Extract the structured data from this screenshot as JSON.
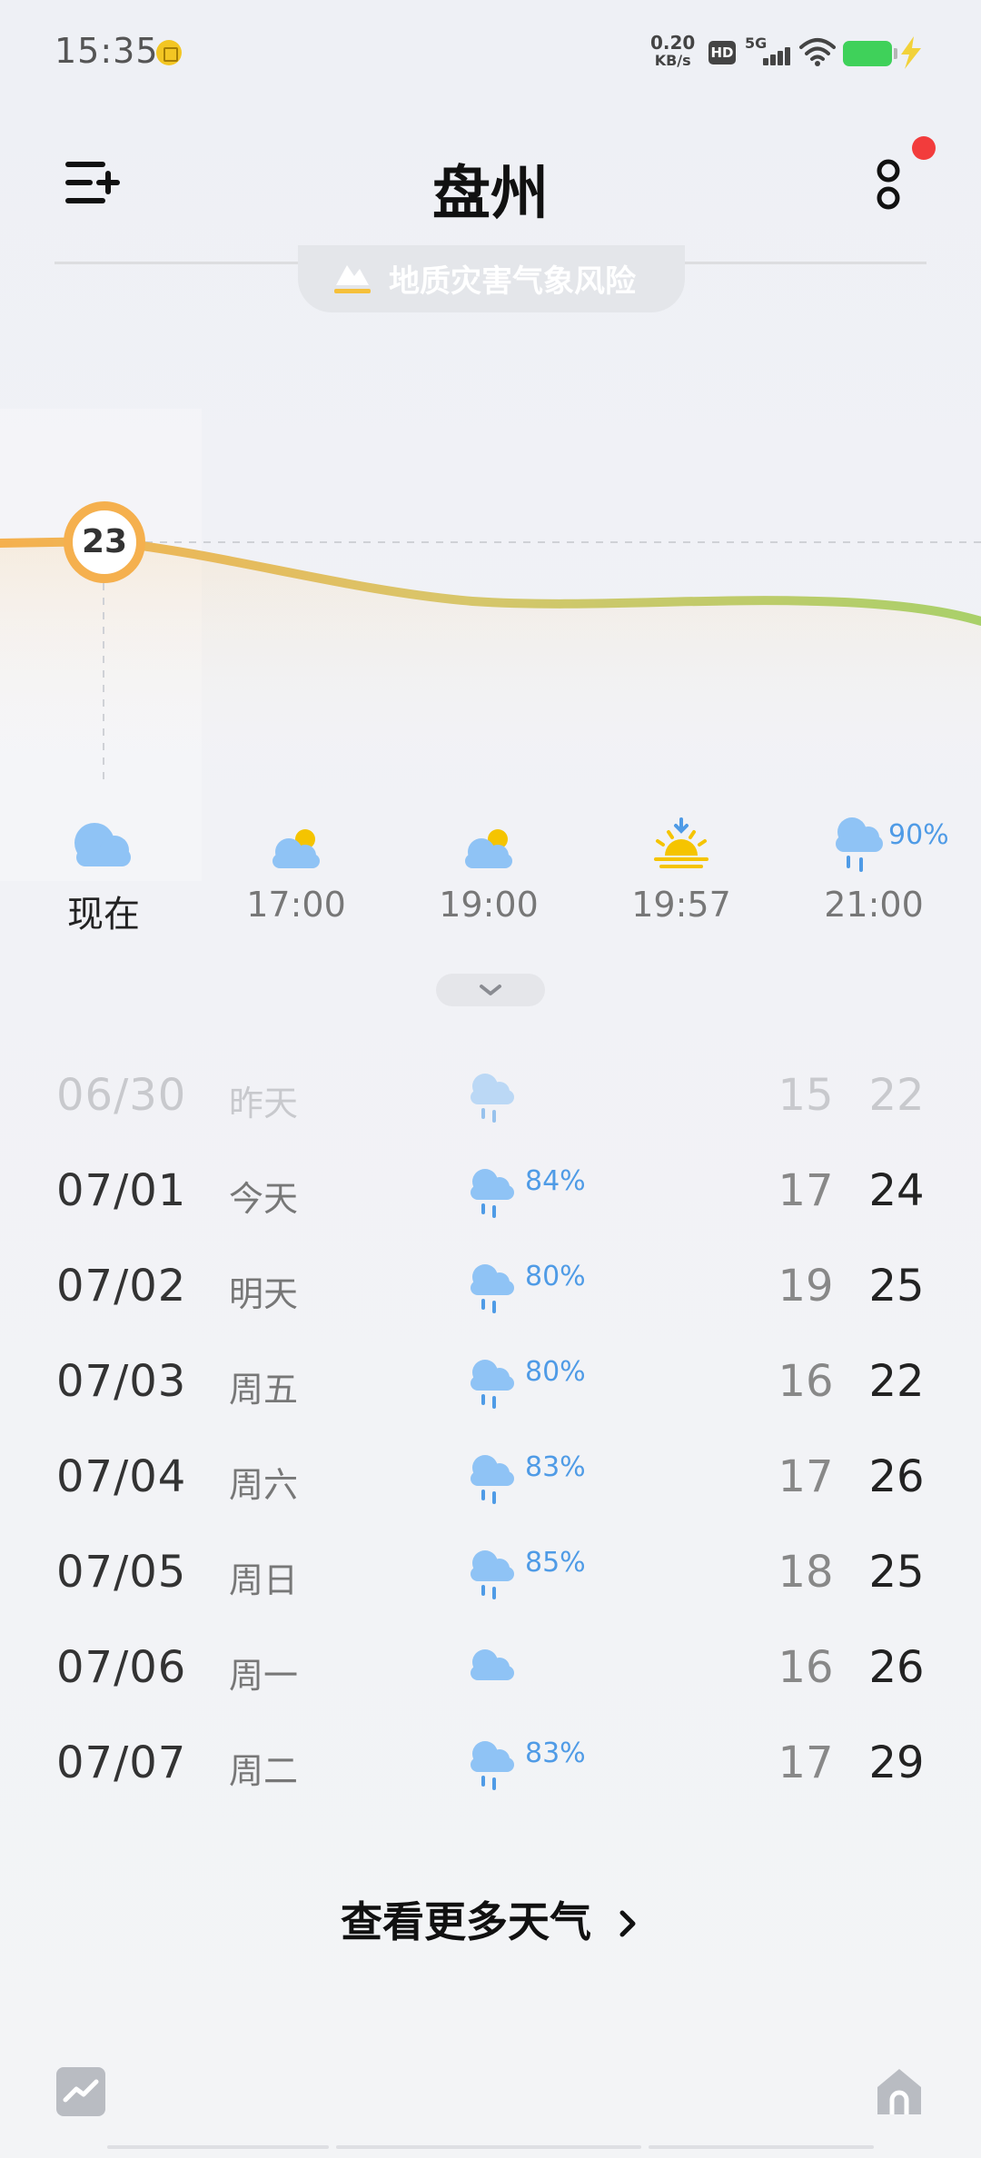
{
  "status_bar": {
    "time": "15:35",
    "net_speed_value": "0.20",
    "net_speed_unit": "KB/s",
    "hd_label": "HD",
    "signal_label": "5G"
  },
  "header": {
    "city": "盘州",
    "warning_text": "地质灾害气象风险"
  },
  "current": {
    "temp": "23"
  },
  "hourly": [
    {
      "label": "现在",
      "icon": "cloudy-icon",
      "precip": ""
    },
    {
      "label": "17:00",
      "icon": "partly-cloudy-icon",
      "precip": ""
    },
    {
      "label": "19:00",
      "icon": "partly-cloudy-icon",
      "precip": ""
    },
    {
      "label": "19:57",
      "icon": "sunset-icon",
      "precip": ""
    },
    {
      "label": "21:00",
      "icon": "rain-icon",
      "precip": "90%"
    }
  ],
  "daily": [
    {
      "date": "06/30",
      "day": "昨天",
      "icon": "rain-icon",
      "precip": "",
      "low": "15",
      "high": "22"
    },
    {
      "date": "07/01",
      "day": "今天",
      "icon": "rain-icon",
      "precip": "84%",
      "low": "17",
      "high": "24"
    },
    {
      "date": "07/02",
      "day": "明天",
      "icon": "rain-icon",
      "precip": "80%",
      "low": "19",
      "high": "25"
    },
    {
      "date": "07/03",
      "day": "周五",
      "icon": "rain-icon",
      "precip": "80%",
      "low": "16",
      "high": "22"
    },
    {
      "date": "07/04",
      "day": "周六",
      "icon": "rain-icon",
      "precip": "83%",
      "low": "17",
      "high": "26"
    },
    {
      "date": "07/05",
      "day": "周日",
      "icon": "rain-icon",
      "precip": "85%",
      "low": "18",
      "high": "25"
    },
    {
      "date": "07/06",
      "day": "周一",
      "icon": "cloudy-icon",
      "precip": "",
      "low": "16",
      "high": "26"
    },
    {
      "date": "07/07",
      "day": "周二",
      "icon": "rain-icon",
      "precip": "83%",
      "low": "17",
      "high": "29"
    }
  ],
  "more_weather_label": "查看更多天气",
  "colors": {
    "accent_orange": "#f5b04e",
    "curve_green": "#a9d06a",
    "precip_blue": "#4f9be6",
    "cloud_blue": "#8fc3f5",
    "alert_red": "#f23c3c"
  }
}
